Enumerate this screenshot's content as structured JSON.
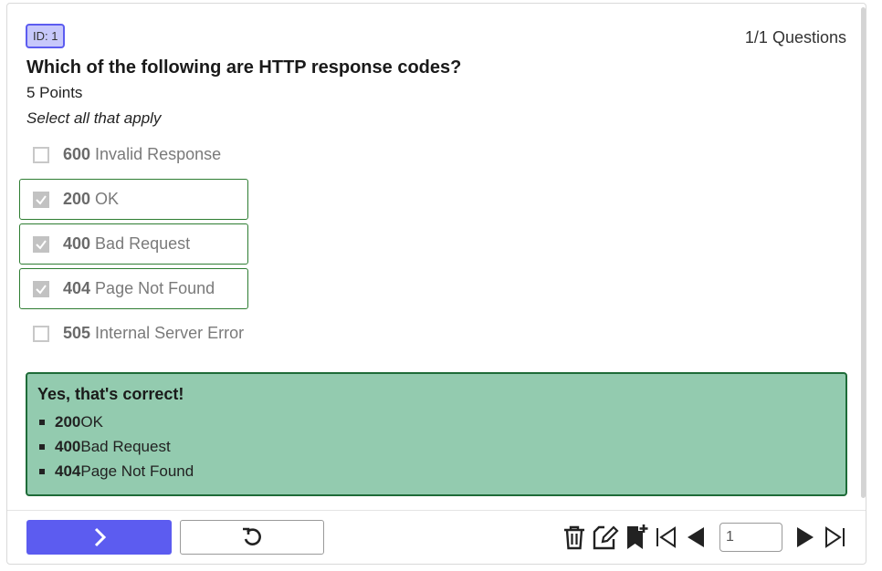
{
  "badge": "ID: 1",
  "counter": "1/1 Questions",
  "question": "Which of the following are HTTP response codes?",
  "points": "5 Points",
  "instruction": "Select all that apply",
  "options": [
    {
      "code": "600",
      "text": " Invalid Response",
      "checked": false
    },
    {
      "code": "200",
      "text": " OK",
      "checked": true
    },
    {
      "code": "400",
      "text": " Bad Request",
      "checked": true
    },
    {
      "code": "404",
      "text": " Page Not Found",
      "checked": true
    },
    {
      "code": "505",
      "text": " Internal Server Error",
      "checked": false
    }
  ],
  "feedback": {
    "title": "Yes, that's correct!",
    "items": [
      {
        "code": "200",
        "text": " OK"
      },
      {
        "code": "400",
        "text": " Bad Request"
      },
      {
        "code": "404",
        "text": " Page Not Found"
      }
    ]
  },
  "pager": {
    "value": "1"
  },
  "icons": {
    "next": "chevron-right-icon",
    "reset": "undo-icon",
    "delete": "trash-icon",
    "edit": "edit-icon",
    "bookmark": "bookmark-add-icon",
    "first": "first-page-icon",
    "prev": "prev-page-icon",
    "next_page": "next-page-icon",
    "last": "last-page-icon"
  },
  "colors": {
    "accent": "#5c5cf0",
    "correct_bg": "#93cbaf",
    "correct_border": "#1e6b38",
    "selected_border": "#2e7d32"
  }
}
